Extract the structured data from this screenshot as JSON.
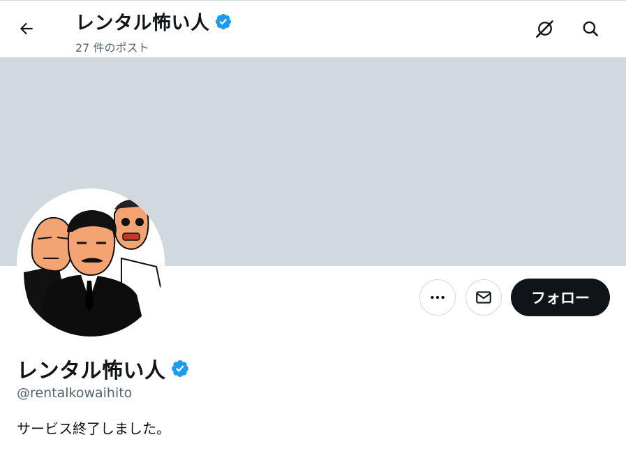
{
  "header": {
    "title": "レンタル怖い人",
    "post_count": "27 件のポスト",
    "back_icon": "arrow-left-icon",
    "grok_icon": "grok-icon",
    "search_icon": "search-icon"
  },
  "profile": {
    "display_name": "レンタル怖い人",
    "handle": "@rentalkowaihito",
    "bio": "サービス終了しました。",
    "verified": true
  },
  "actions": {
    "more_icon": "more-dots-icon",
    "message_icon": "envelope-icon",
    "follow_label": "フォロー"
  },
  "colors": {
    "verified_blue": "#1d9bf0",
    "banner_gray": "#cfd9de",
    "follow_bg": "#0f1419",
    "secondary_text": "#536471"
  }
}
